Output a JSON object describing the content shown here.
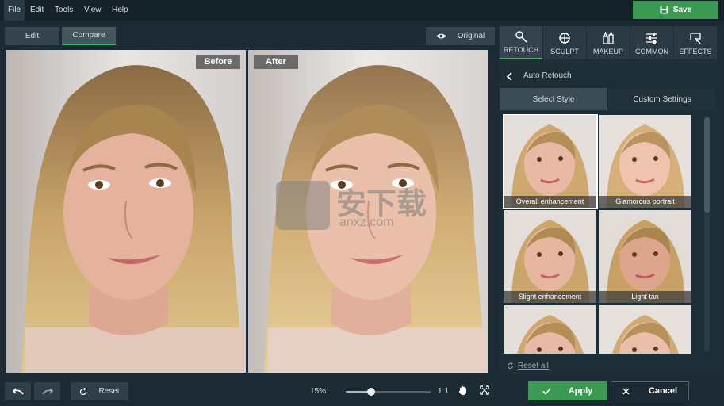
{
  "menu": [
    "File",
    "Edit",
    "Tools",
    "View",
    "Help"
  ],
  "save_label": "Save",
  "toolbar": {
    "edit_label": "Edit",
    "compare_label": "Compare",
    "original_label": "Original"
  },
  "compare": {
    "before_label": "Before",
    "after_label": "After"
  },
  "tabs": [
    {
      "label": "RETOUCH",
      "icon": "retouch-icon"
    },
    {
      "label": "SCULPT",
      "icon": "sculpt-icon"
    },
    {
      "label": "MAKEUP",
      "icon": "makeup-icon"
    },
    {
      "label": "COMMON",
      "icon": "sliders-icon"
    },
    {
      "label": "EFFECTS",
      "icon": "effects-icon"
    }
  ],
  "panel": {
    "title": "Auto Retouch",
    "subtabs": [
      "Select Style",
      "Custom Settings"
    ],
    "styles": [
      "Overall enhancement",
      "Glamorous portrait",
      "Slight enhancement",
      "Light tan",
      "",
      ""
    ],
    "reset_all": "Reset all"
  },
  "bottom": {
    "reset_label": "Reset",
    "zoom": "15%",
    "zoom_fraction": 0.3,
    "ratio": "1:1",
    "apply_label": "Apply",
    "cancel_label": "Cancel"
  },
  "watermark": {
    "text": "安下载",
    "sub": "anxz.com"
  },
  "colors": {
    "accent": "#3fb35f",
    "save": "#3a9a52",
    "bg": "#1b2a33"
  }
}
